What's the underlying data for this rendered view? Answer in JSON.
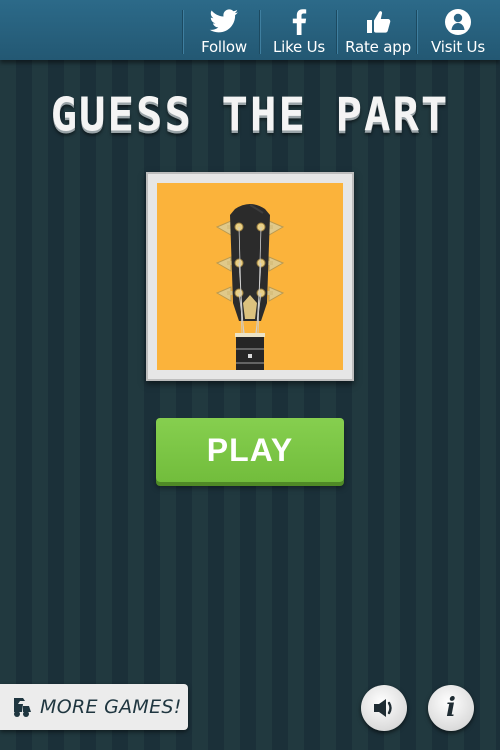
{
  "topbar": {
    "items": [
      {
        "label": "Follow",
        "icon": "twitter-icon"
      },
      {
        "label": "Like Us",
        "icon": "facebook-icon"
      },
      {
        "label": "Rate app",
        "icon": "thumbs-up-icon"
      },
      {
        "label": "Visit Us",
        "icon": "person-icon"
      }
    ]
  },
  "title": "GUESS THE PART",
  "puzzle_image": {
    "subject": "guitar headstock",
    "background_color": "#fbb33b"
  },
  "play_label": "PLAY",
  "more_games_label": "MORE GAMES!",
  "controls": {
    "sound_icon": "speaker-icon",
    "info_icon": "info-icon"
  },
  "colors": {
    "topbar": "#2a6585",
    "background": "#1f3640",
    "play_button": "#7cc746",
    "accent_frame": "#e6e6e6"
  }
}
